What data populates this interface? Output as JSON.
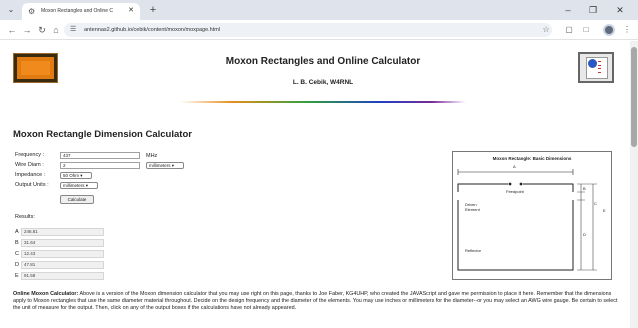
{
  "browser": {
    "tab_title": "Moxon Rectangles and Online C",
    "url": "antennas2.github.io/cebik/content/moxon/moxpage.html"
  },
  "header": {
    "title": "Moxon Rectangles and Online Calculator",
    "author": "L. B. Cebik, W4RNL"
  },
  "calculator": {
    "heading": "Moxon Rectangle Dimension Calculator",
    "frequency_label": "Frequency :",
    "frequency_value": "437",
    "frequency_unit": "MHz",
    "wire_label": "Wire Diam :",
    "wire_value": "2",
    "wire_unit_select": "millimeters",
    "impedance_label": "Impedance :",
    "impedance_select": "50 Ohm",
    "output_label": "Output Units :",
    "output_select": "millimeters",
    "calc_button": "Calculate",
    "results_label": "Results:",
    "results": [
      {
        "letter": "A",
        "value": "246.81"
      },
      {
        "letter": "B",
        "value": "31.64"
      },
      {
        "letter": "C",
        "value": "12.43"
      },
      {
        "letter": "D",
        "value": "47.81"
      },
      {
        "letter": "E",
        "value": "91.58"
      }
    ]
  },
  "diagram": {
    "title": "Moxon Rectangle:  Basic Dimensions",
    "label_a": "A",
    "label_b": "B",
    "label_c": "C",
    "label_d": "D",
    "label_e": "E",
    "feedpoint": "Feedpoint",
    "driven": "Driven Element",
    "reflector": "Reflector"
  },
  "description": {
    "lead": "Online Moxon Calculator:",
    "text": " Above is a version of the Moxon dimension calculator that you may use right on this page, thanks to Joe Faber, KG4UHP, who created the JAVAScript and gave me permission to place it here. Remember that the dimensions apply to Moxon rectangles that use the same diameter material throughout. Decide on the design frequency and the diameter of the elements. You may use inches or millimeters for the diameter--or you may select an AWG wire gauge. Be certain to select the unit of measure for the output. Then, click on any of the output boxes if the calculations have not already appeared."
  }
}
